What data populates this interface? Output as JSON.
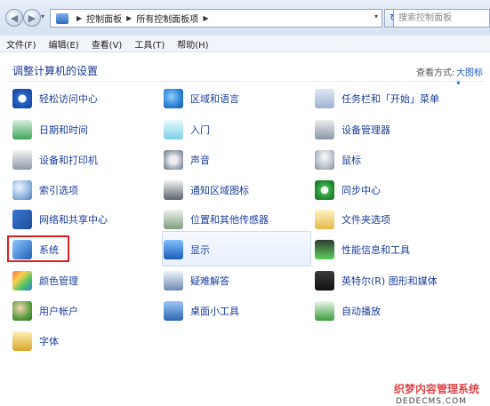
{
  "address_bar": {
    "crumbs": [
      "控制面板",
      "所有控制面板项"
    ],
    "search_placeholder": "搜索控制面板"
  },
  "menu": [
    "文件(F)",
    "编辑(E)",
    "查看(V)",
    "工具(T)",
    "帮助(H)"
  ],
  "header": {
    "title": "调整计算机的设置",
    "view_label": "查看方式:",
    "view_value": "大图标 ▾"
  },
  "items": [
    {
      "label": "轻松访问中心",
      "icon": "ease-of-access-icon"
    },
    {
      "label": "区域和语言",
      "icon": "region-language-icon"
    },
    {
      "label": "任务栏和「开始」菜单",
      "icon": "taskbar-icon"
    },
    {
      "label": "日期和时间",
      "icon": "date-time-icon"
    },
    {
      "label": "入门",
      "icon": "getting-started-icon"
    },
    {
      "label": "设备管理器",
      "icon": "device-manager-icon"
    },
    {
      "label": "设备和打印机",
      "icon": "printer-icon"
    },
    {
      "label": "声音",
      "icon": "sound-icon"
    },
    {
      "label": "鼠标",
      "icon": "mouse-icon"
    },
    {
      "label": "索引选项",
      "icon": "indexing-icon"
    },
    {
      "label": "通知区域图标",
      "icon": "notification-icon"
    },
    {
      "label": "同步中心",
      "icon": "sync-icon"
    },
    {
      "label": "网络和共享中心",
      "icon": "network-icon"
    },
    {
      "label": "位置和其他传感器",
      "icon": "location-icon"
    },
    {
      "label": "文件夹选项",
      "icon": "folder-options-icon"
    },
    {
      "label": "系统",
      "icon": "system-icon"
    },
    {
      "label": "显示",
      "icon": "display-icon"
    },
    {
      "label": "性能信息和工具",
      "icon": "performance-icon"
    },
    {
      "label": "颜色管理",
      "icon": "color-management-icon"
    },
    {
      "label": "疑难解答",
      "icon": "troubleshooting-icon"
    },
    {
      "label": "英特尔(R) 图形和媒体",
      "icon": "intel-graphics-icon"
    },
    {
      "label": "用户帐户",
      "icon": "user-accounts-icon"
    },
    {
      "label": "桌面小工具",
      "icon": "gadgets-icon"
    },
    {
      "label": "自动播放",
      "icon": "autoplay-icon"
    },
    {
      "label": "字体",
      "icon": "fonts-icon"
    }
  ],
  "watermark": {
    "line1": "织梦内容管理系统",
    "line2": "DEDECMS.COM"
  }
}
